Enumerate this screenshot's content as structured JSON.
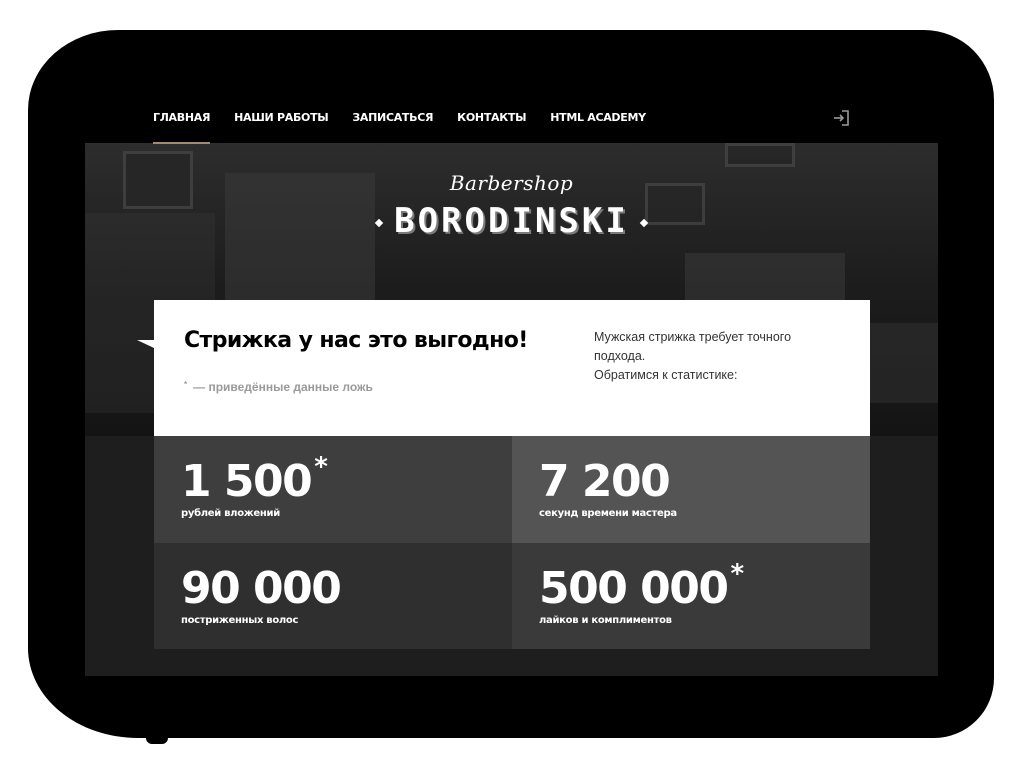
{
  "colors": {
    "page_background": "#ffffff",
    "device_frame": "#000000",
    "nav_text": "#ffffff",
    "nav_active_underline": "#a58a73",
    "promo_background": "#ffffff",
    "promo_note": "#9a9a9a",
    "stat_tiles": [
      "#3e3e3e",
      "#545454",
      "#2f2f2f",
      "#3a3a3a"
    ]
  },
  "nav": {
    "items": [
      {
        "label": "Главная",
        "active": true
      },
      {
        "label": "Наши работы",
        "active": false
      },
      {
        "label": "Записаться",
        "active": false
      },
      {
        "label": "Контакты",
        "active": false
      },
      {
        "label": "HTML Academy",
        "active": false
      }
    ],
    "login_icon": "login-icon"
  },
  "logo": {
    "script": "Barbershop",
    "main": "BORODINSKI"
  },
  "promo": {
    "title": "Стрижка у нас это выгодно!",
    "note_mark": "*",
    "note": "— приведённые данные ложь",
    "text_line1": "Мужская стрижка требует точного подхода.",
    "text_line2": "Обратимся к статистике:"
  },
  "stats": [
    {
      "number": "1 500",
      "star": "*",
      "label": "рублей вложений"
    },
    {
      "number": "7 200",
      "star": "",
      "label": "секунд времени мастера"
    },
    {
      "number": "90 000",
      "star": "",
      "label": "постриженных волос"
    },
    {
      "number": "500 000",
      "star": "*",
      "label": "лайков и комплиментов"
    }
  ]
}
